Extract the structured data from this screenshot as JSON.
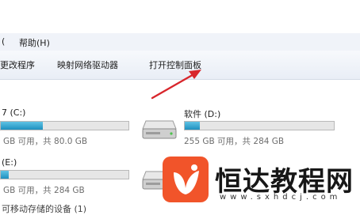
{
  "menubar": {
    "items": [
      {
        "label": "("
      },
      {
        "label": "帮助(H)"
      }
    ]
  },
  "toolbar": {
    "buttons": [
      {
        "label": "更改程序"
      },
      {
        "label": "映射网络驱动器"
      },
      {
        "label": "打开控制面板"
      }
    ]
  },
  "drives": [
    {
      "name": "7 (C:)",
      "info": "GB 可用，共 80.0 GB",
      "usage": 0.33
    },
    {
      "name": "软件 (D:)",
      "info": "255 GB 可用，共 284 GB",
      "usage": 0.1
    },
    {
      "name": "(E:)",
      "info": "GB 可用，共 284 GB",
      "usage": 0.06
    }
  ],
  "footer": {
    "label": "可移动存储的设备 (1)"
  },
  "watermark": {
    "name": "恒达教程网",
    "url": "www.sxhdcj.com"
  },
  "colors": {
    "arrow": "#d8262c",
    "bar_fill": "#26a0da",
    "logo": "#f1542a"
  }
}
